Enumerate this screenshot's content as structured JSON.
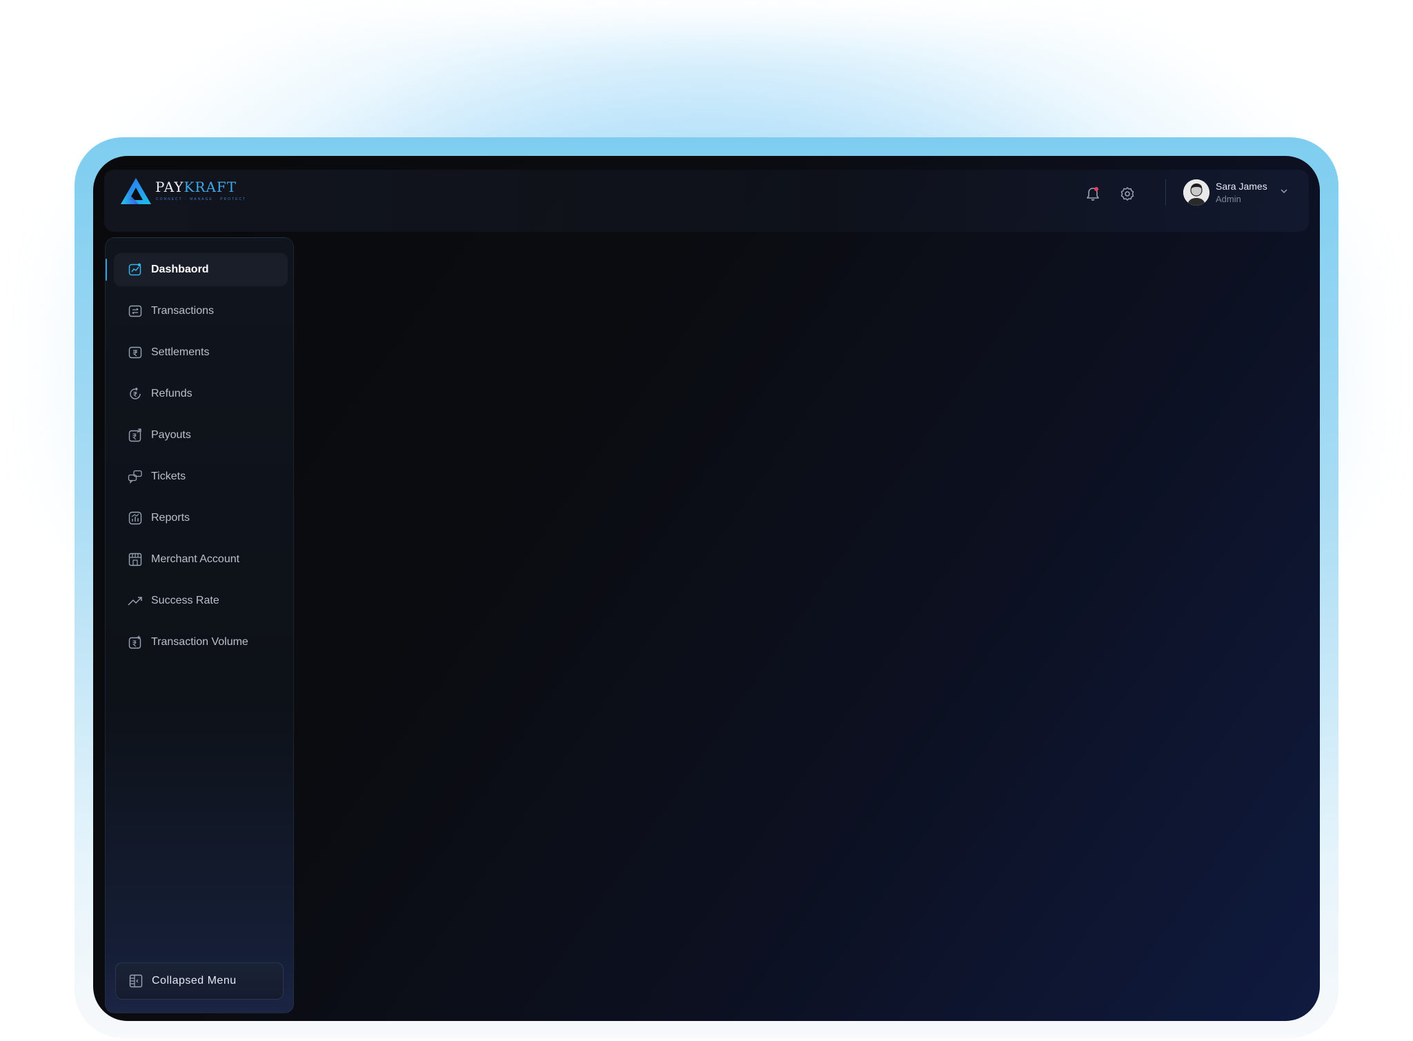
{
  "brand": {
    "name_part1": "PAY",
    "name_part2": "KRAFT",
    "tagline": "CONNECT · MANAGE · PROTECT",
    "accent_color": "#2da6e0"
  },
  "header": {
    "notifications_icon": "bell-icon",
    "settings_icon": "gear-icon",
    "user": {
      "name": "Sara James",
      "role": "Admin"
    }
  },
  "sidebar": {
    "items": [
      {
        "label": "Dashbaord",
        "icon": "chart-icon",
        "active": true
      },
      {
        "label": "Transactions",
        "icon": "transfer-icon"
      },
      {
        "label": "Settlements",
        "icon": "rupee-icon"
      },
      {
        "label": "Refunds",
        "icon": "refund-icon"
      },
      {
        "label": "Payouts",
        "icon": "payout-icon"
      },
      {
        "label": "Tickets",
        "icon": "ticket-icon"
      },
      {
        "label": "Reports",
        "icon": "report-icon"
      },
      {
        "label": "Merchant Account",
        "icon": "store-icon"
      },
      {
        "label": "Success Rate",
        "icon": "trend-up-icon"
      },
      {
        "label": "Transaction Volume",
        "icon": "volume-icon"
      }
    ],
    "collapse_label": "Collapsed Menu"
  }
}
